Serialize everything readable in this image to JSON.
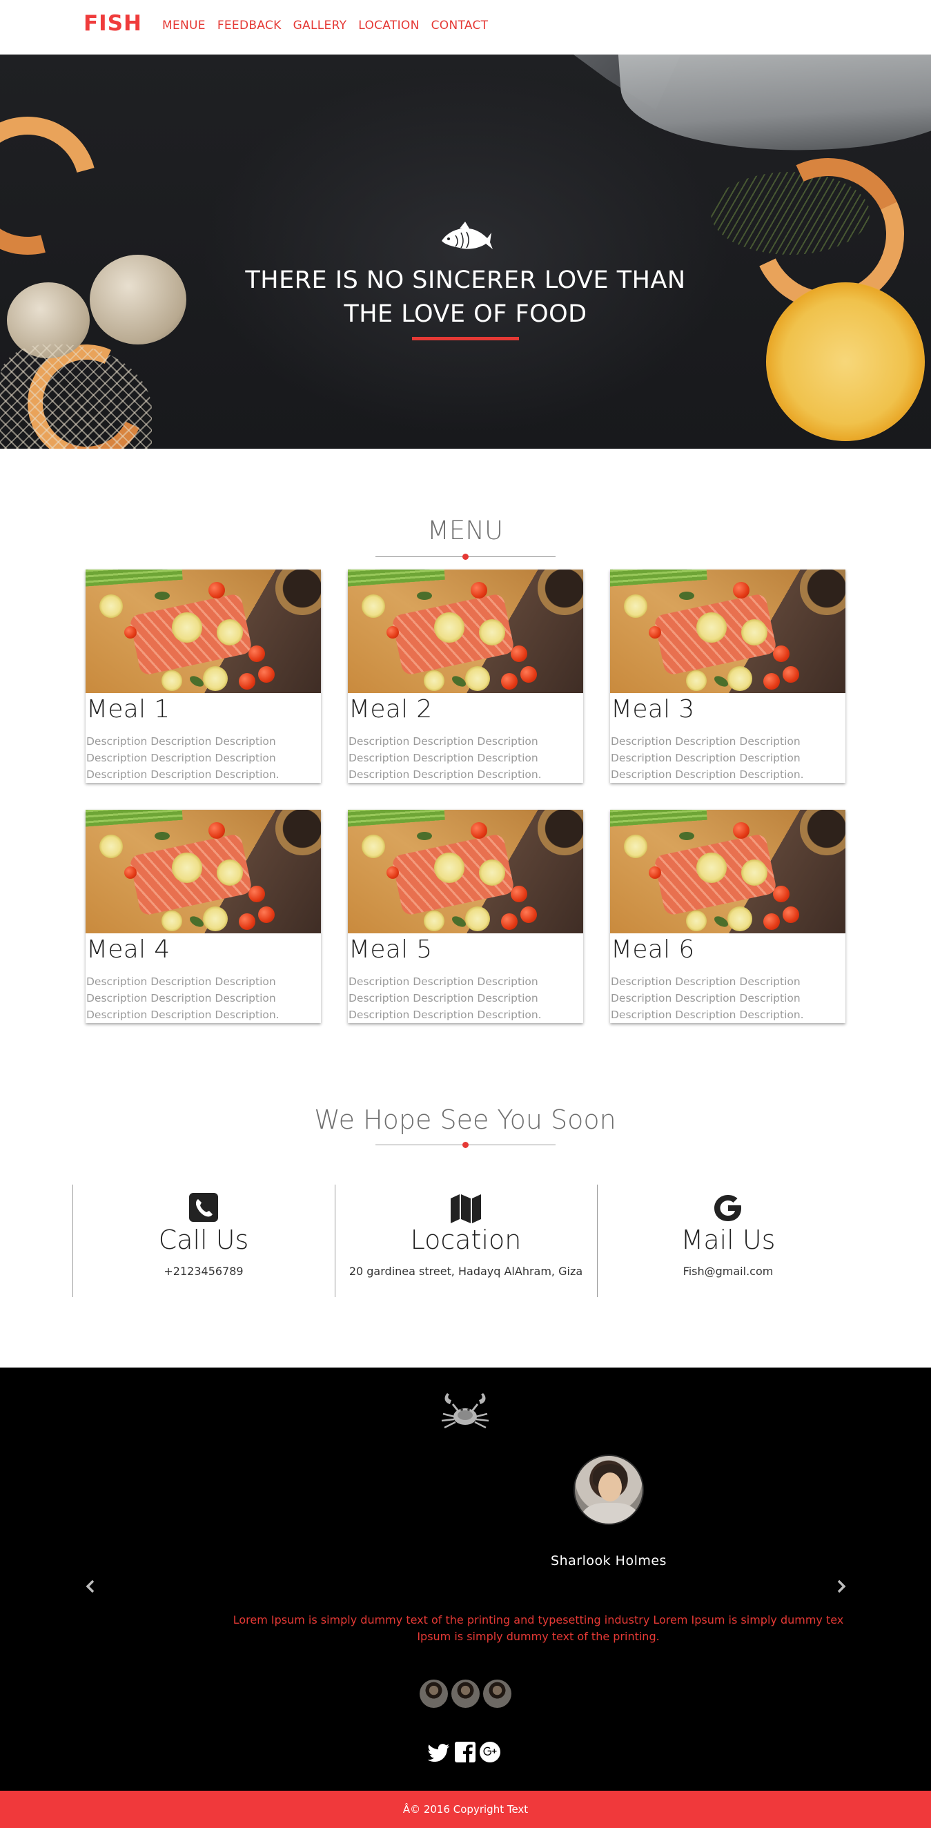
{
  "nav": {
    "brand": "FISH",
    "links": [
      "MENUE",
      "FEEDBACK",
      "GALLERY",
      "LOCATION",
      "CONTACT"
    ]
  },
  "hero": {
    "quote_line1": "THERE IS NO SINCERER LOVE THAN",
    "quote_line2": "THE LOVE OF FOOD",
    "icon": "fish-icon"
  },
  "menu": {
    "title": "MENU",
    "items": [
      {
        "name": "Meal 1",
        "desc": [
          "Description Description Description",
          "Description Description Description",
          "Description Description Description."
        ]
      },
      {
        "name": "Meal 2",
        "desc": [
          "Description Description Description",
          "Description Description Description",
          "Description Description Description."
        ]
      },
      {
        "name": "Meal 3",
        "desc": [
          "Description Description Description",
          "Description Description Description",
          "Description Description Description."
        ]
      },
      {
        "name": "Meal 4",
        "desc": [
          "Description Description Description",
          "Description Description Description",
          "Description Description Description."
        ]
      },
      {
        "name": "Meal 5",
        "desc": [
          "Description Description Description",
          "Description Description Description",
          "Description Description Description."
        ]
      },
      {
        "name": "Meal 6",
        "desc": [
          "Description Description Description",
          "Description Description Description",
          "Description Description Description."
        ]
      }
    ]
  },
  "contact": {
    "title": "We Hope See You Soon",
    "items": [
      {
        "icon": "phone-icon",
        "heading": "Call Us",
        "detail": "+2123456789"
      },
      {
        "icon": "map-icon",
        "heading": "Location",
        "detail": "20 gardinea street, Hadayq AlAhram, Giza"
      },
      {
        "icon": "google-icon",
        "heading": "Mail Us",
        "detail": "Fish@gmail.com"
      }
    ]
  },
  "footer": {
    "logo_icon": "crab-icon",
    "testimonial": {
      "name": "Sharlook Holmes",
      "text_line1": "Lorem Ipsum is simply dummy text of the printing and typesetting industry Lorem Ipsum is simply dummy tex",
      "text_line2": "Ipsum is simply dummy text of the printing."
    },
    "social_icons": [
      "twitter-icon",
      "facebook-icon",
      "google-plus-icon"
    ],
    "copyright": "Â© 2016 Copyright Text"
  },
  "colors": {
    "accent": "#e53935",
    "footer_bg": "#000000",
    "copyright_bg": "#f0393b"
  }
}
